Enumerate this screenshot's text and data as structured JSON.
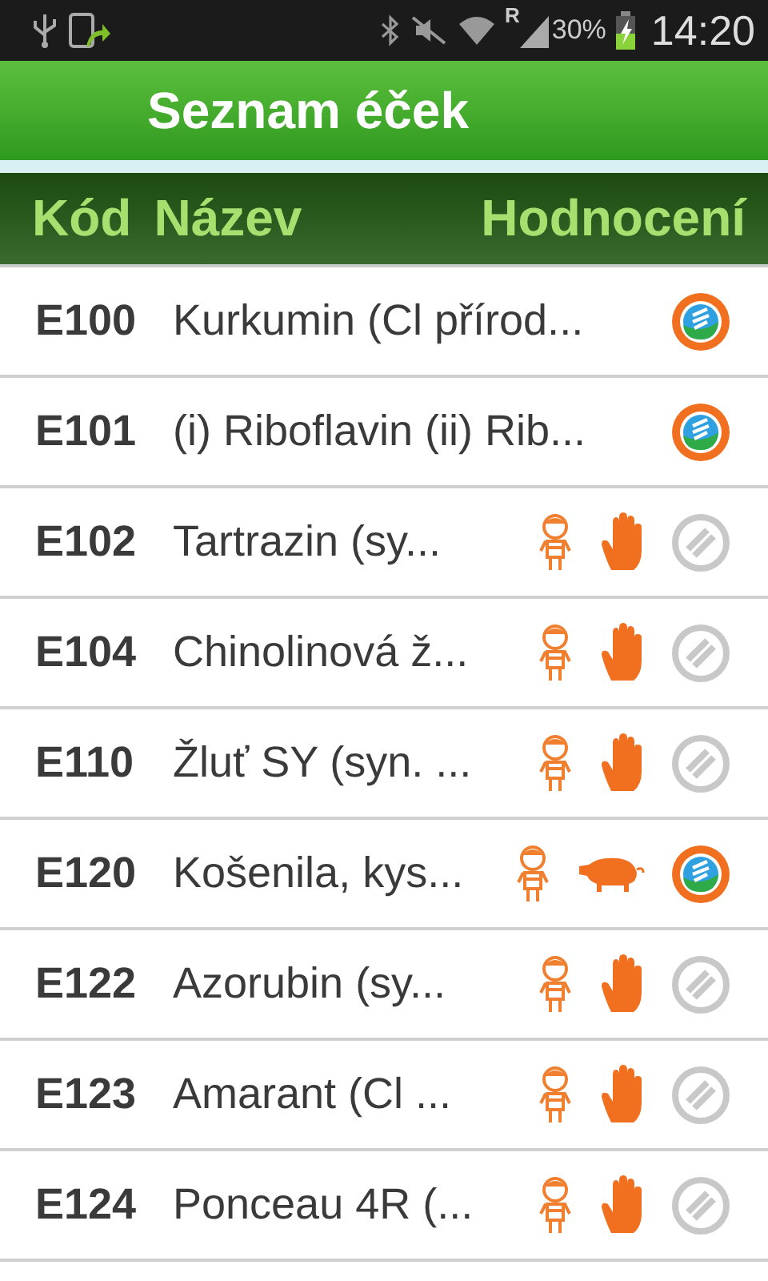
{
  "status_bar": {
    "battery_text": "30%",
    "time": "14:20",
    "network_letter": "R"
  },
  "title": "Seznam éček",
  "columns": [
    "Kód",
    "Název",
    "Hodnocení"
  ],
  "rows": [
    {
      "code": "E100",
      "name": "Kurkumin (Cl přírod...",
      "ratings": [
        {
          "kind": "approved"
        }
      ]
    },
    {
      "code": "E101",
      "name": "(i) Riboflavin (ii) Rib...",
      "ratings": [
        {
          "kind": "approved"
        }
      ]
    },
    {
      "code": "E102",
      "name": "Tartrazin (sy...",
      "ratings": [
        {
          "kind": "child"
        },
        {
          "kind": "hand"
        },
        {
          "kind": "neutral"
        }
      ]
    },
    {
      "code": "E104",
      "name": "Chinolinová ž...",
      "ratings": [
        {
          "kind": "child"
        },
        {
          "kind": "hand"
        },
        {
          "kind": "neutral"
        }
      ]
    },
    {
      "code": "E110",
      "name": "Žluť SY (syn. ...",
      "ratings": [
        {
          "kind": "child"
        },
        {
          "kind": "hand"
        },
        {
          "kind": "neutral"
        }
      ]
    },
    {
      "code": "E120",
      "name": "Košenila, kys...",
      "ratings": [
        {
          "kind": "child"
        },
        {
          "kind": "pig"
        },
        {
          "kind": "approved"
        }
      ]
    },
    {
      "code": "E122",
      "name": "Azorubin (sy...",
      "ratings": [
        {
          "kind": "child"
        },
        {
          "kind": "hand"
        },
        {
          "kind": "neutral"
        }
      ]
    },
    {
      "code": "E123",
      "name": "Amarant (Cl ...",
      "ratings": [
        {
          "kind": "child"
        },
        {
          "kind": "hand"
        },
        {
          "kind": "neutral"
        }
      ]
    },
    {
      "code": "E124",
      "name": "Ponceau 4R (...",
      "ratings": [
        {
          "kind": "child"
        },
        {
          "kind": "hand"
        },
        {
          "kind": "neutral"
        }
      ]
    }
  ]
}
